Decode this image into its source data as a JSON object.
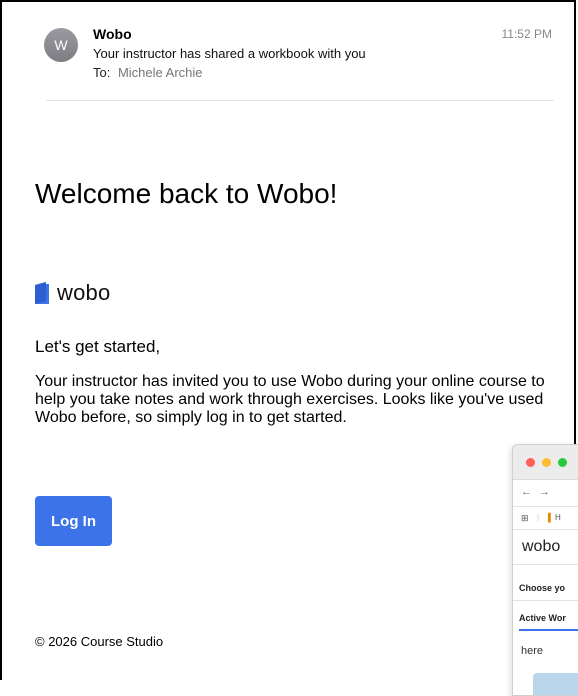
{
  "email": {
    "avatar_initial": "W",
    "sender": "Wobo",
    "subject": "Your instructor has shared a workbook with you",
    "to_label": "To:",
    "to_name": "Michele Archie",
    "time": "11:52 PM"
  },
  "content": {
    "heading": "Welcome back to Wobo!",
    "logo_text": "wobo",
    "greeting": "Let's get started,",
    "body": "Your instructor has invited you to use Wobo during your online course to help you take notes and work through exercises. Looks like you've used Wobo before, so simply log in to get started.",
    "login_label": "Log In",
    "footer": "© 2026 Course Studio"
  },
  "preview": {
    "nav_back": "←",
    "nav_forward": "→",
    "bookmark_text": "H",
    "brand": "wobo",
    "choose_text": "Choose yo",
    "tab_label": "Active Wor",
    "here_text": "here"
  },
  "colors": {
    "accent": "#3c73e8",
    "avatar": "#8a8a90"
  }
}
